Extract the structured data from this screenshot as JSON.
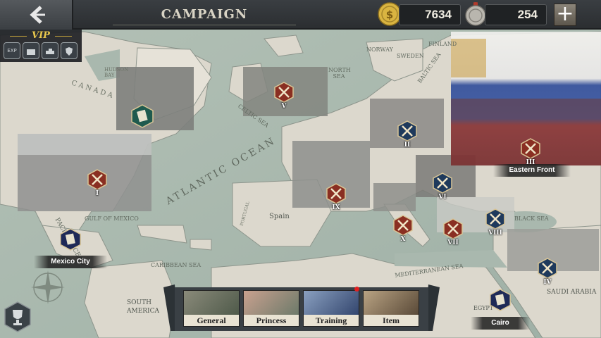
{
  "header": {
    "title": "CAMPAIGN",
    "gold": "7634",
    "medals": "254",
    "add_label": "+"
  },
  "vip": {
    "title": "VIP",
    "badges": [
      "EXP",
      "",
      "",
      ""
    ]
  },
  "map_labels": {
    "canada": "CANADA",
    "hudson_bay": "HUDSON BAY",
    "atlantic": "ATLANTIC OCEAN",
    "celtic": "CELTIC SEA",
    "north_sea": "NORTH SEA",
    "baltic": "BALTIC SEA",
    "norway": "NORWAY",
    "sweden": "SWEDEN",
    "finland": "FINLAND",
    "spain": "Spain",
    "portugal": "PORTUGAL",
    "gulf": "GULF OF MEXICO",
    "caribbean": "CARIBBEAN SEA",
    "mediterranean": "MEDITERRANEAN SEA",
    "black_sea": "BLACK SEA",
    "saudi": "SAUDI ARABIA",
    "south_america": "SOUTH AMERICA",
    "pacific": "PACIFIC OCEAN",
    "egypt": "EGYPT"
  },
  "chapters": [
    {
      "numeral": "I",
      "state": "done"
    },
    {
      "numeral": "II",
      "state": "open"
    },
    {
      "numeral": "III",
      "state": "done"
    },
    {
      "numeral": "IV",
      "state": "open"
    },
    {
      "numeral": "V",
      "state": "done"
    },
    {
      "numeral": "VI",
      "state": "open"
    },
    {
      "numeral": "VII",
      "state": "done"
    },
    {
      "numeral": "VIII",
      "state": "open"
    },
    {
      "numeral": "IX",
      "state": "done"
    },
    {
      "numeral": "X",
      "state": "done"
    }
  ],
  "places": {
    "eastern_front": "Eastern Front",
    "mexico_city": "Mexico City",
    "cairo": "Cairo"
  },
  "menu": [
    {
      "label": "General"
    },
    {
      "label": "Princess"
    },
    {
      "label": "Training"
    },
    {
      "label": "Item"
    }
  ],
  "colors": {
    "sea": "#a9b8ae",
    "land": "#dedad0",
    "done_marker": "#8a2f22",
    "open_marker": "#1f3a5c",
    "gold": "#d9b441"
  }
}
